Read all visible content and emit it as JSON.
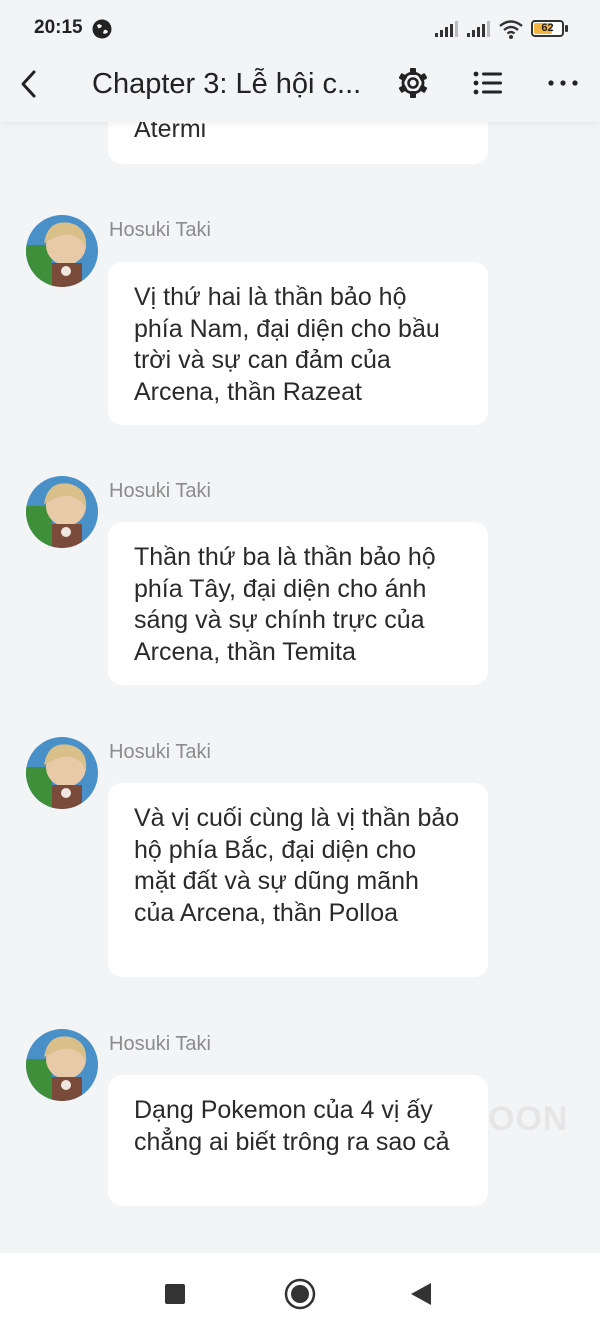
{
  "status_bar": {
    "time": "20:15",
    "battery": "62",
    "icons": [
      "globe-icon",
      "signal-icon",
      "signal-icon",
      "wifi-icon",
      "battery-icon"
    ]
  },
  "toolbar": {
    "title": "Chapter 3: Lễ hội c...",
    "icons": [
      "back-arrow-icon",
      "gear-icon",
      "list-icon",
      "more-icon"
    ]
  },
  "messages": [
    {
      "sender": "",
      "text": "Atermi"
    },
    {
      "sender": "Hosuki Taki",
      "text": "Vị thứ hai là thần bảo hộ phía Nam, đại diện cho bầu trời và sự can đảm của Arcena, thần Razeat"
    },
    {
      "sender": "Hosuki Taki",
      "text": "Thần thứ ba là thần bảo hộ phía Tây, đại diện cho ánh sáng và sự chính trực của Arcena, thần Temita"
    },
    {
      "sender": "Hosuki Taki",
      "text": "Và vị cuối cùng là vị thần bảo hộ phía Bắc, đại diện cho mặt đất và sự dũng mãnh của Arcena, thần Polloa"
    },
    {
      "sender": "Hosuki Taki",
      "text": "Dạng Pokemon của 4 vị ấy chẳng ai biết trông ra sao cả"
    }
  ],
  "watermark": "OON",
  "nav_bar": {
    "icons": [
      "recent-apps-icon",
      "home-icon",
      "back-icon"
    ]
  },
  "colors": {
    "background": "#f3f4f6",
    "bubble": "#ffffff",
    "sender_text": "#8c8c8c",
    "battery_fill": "#f2b544"
  }
}
